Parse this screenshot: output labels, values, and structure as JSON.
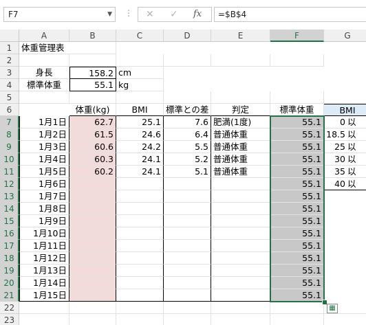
{
  "name_box": "F7",
  "formula": "=$B$4",
  "columns": [
    "A",
    "B",
    "C",
    "D",
    "E",
    "F",
    "G"
  ],
  "selected_column": "F",
  "rows": [
    "1",
    "2",
    "3",
    "4",
    "5",
    "6",
    "7",
    "8",
    "9",
    "10",
    "11",
    "12",
    "13",
    "14",
    "15",
    "16",
    "17",
    "18",
    "19",
    "20",
    "21",
    "22",
    "23"
  ],
  "selected_rows": [
    "7",
    "8",
    "9",
    "10",
    "11",
    "12",
    "13",
    "14",
    "15",
    "16",
    "17",
    "18",
    "19",
    "20",
    "21"
  ],
  "title": "体重管理表",
  "height_label": "身長",
  "height_value": "158.2",
  "height_unit": "cm",
  "std_label": "標準体重",
  "std_value": "55.1",
  "std_unit": "kg",
  "headers": {
    "weight": "体重(kg)",
    "bmi": "BMI",
    "diff": "標準との差",
    "judge": "判定",
    "std": "標準体重",
    "bmi_table": "BMI"
  },
  "dates": [
    "1月1日",
    "1月2日",
    "1月3日",
    "1月4日",
    "1月5日",
    "1月6日",
    "1月7日",
    "1月8日",
    "1月9日",
    "1月10日",
    "1月11日",
    "1月12日",
    "1月13日",
    "1月14日",
    "1月15日"
  ],
  "weights": [
    "62.7",
    "61.5",
    "60.6",
    "60.3",
    "60.2",
    "",
    "",
    "",
    "",
    "",
    "",
    "",
    "",
    "",
    ""
  ],
  "bmis": [
    "25.1",
    "24.6",
    "24.2",
    "24.1",
    "24.1",
    "",
    "",
    "",
    "",
    "",
    "",
    "",
    "",
    "",
    ""
  ],
  "diffs": [
    "7.6",
    "6.4",
    "5.5",
    "5.2",
    "5.1",
    "",
    "",
    "",
    "",
    "",
    "",
    "",
    "",
    "",
    ""
  ],
  "judges": [
    "肥満(1度)",
    "普通体重",
    "普通体重",
    "普通体重",
    "普通体重",
    "",
    "",
    "",
    "",
    "",
    "",
    "",
    "",
    "",
    ""
  ],
  "std_col": [
    "55.1",
    "55.1",
    "55.1",
    "55.1",
    "55.1",
    "55.1",
    "55.1",
    "55.1",
    "55.1",
    "55.1",
    "55.1",
    "55.1",
    "55.1",
    "55.1",
    "55.1"
  ],
  "bmi_table": [
    "0",
    "18.5",
    "25",
    "30",
    "35",
    "40"
  ],
  "bmi_table_suffix": "以",
  "colors": {
    "selection": "#217346",
    "weight_fill": "#f2dcdb",
    "selected_fill": "#c8c8c8",
    "header_fill": "#ddebf7"
  }
}
